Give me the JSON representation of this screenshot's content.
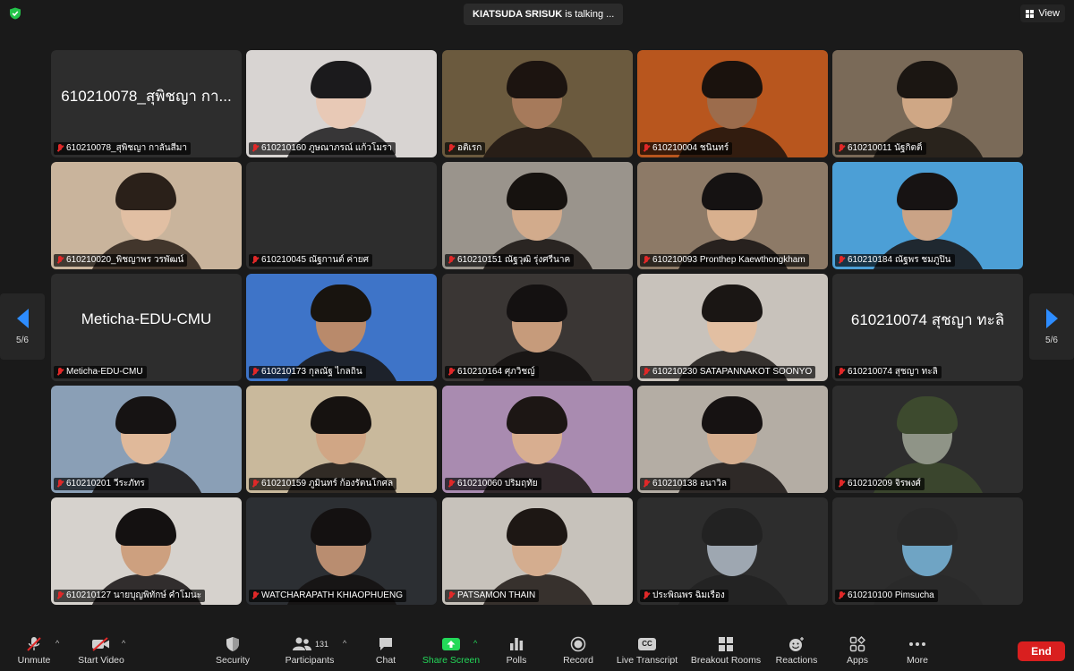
{
  "topbar": {
    "talking_name": "KIATSUDA SRISUK",
    "talking_suffix": "is talking ...",
    "view_label": "View"
  },
  "pager": {
    "left_label": "5/6",
    "right_label": "5/6"
  },
  "participants": [
    {
      "label": "610210078_สุพิชญา กาลันสีมา",
      "big_name": "610210078_สุพิชญา กา...",
      "video": false
    },
    {
      "label": "610210160 ภูษณาภรณ์ แก้วโมรา",
      "big_name": "",
      "video": true,
      "bg": "#d8d4d2",
      "skin": "#e8c9b6",
      "hair": "#1b1a1c"
    },
    {
      "label": "อติเรก",
      "big_name": "",
      "video": true,
      "bg": "#6b5a3e",
      "skin": "#a67a5b",
      "hair": "#1c1410"
    },
    {
      "label": "610210004 ชนินทร์",
      "big_name": "",
      "video": true,
      "bg": "#b8561e",
      "skin": "#9c6c4c",
      "hair": "#1a120d"
    },
    {
      "label": "610210011 นัฐกิตติ์",
      "big_name": "",
      "video": true,
      "bg": "#7a6a58",
      "skin": "#cfa785",
      "hair": "#1b1612"
    },
    {
      "label": "610210020_พิชญาพร วรพัฒน์",
      "big_name": "",
      "video": true,
      "bg": "#c9b49c",
      "skin": "#e1bfa3",
      "hair": "#2a2019"
    },
    {
      "label": "610210045 ณัฐกานต์ ค่ายศ",
      "big_name": "",
      "video": false
    },
    {
      "label": "610210151 ณัฐวุฒิ รุ่งศรีนาค",
      "big_name": "",
      "video": true,
      "bg": "#9a948c",
      "skin": "#d2ab8c",
      "hair": "#16120f"
    },
    {
      "label": "610210093 Pronthep Kaewthongkham",
      "big_name": "",
      "video": true,
      "bg": "#8d7a67",
      "skin": "#d8b08e",
      "hair": "#151212"
    },
    {
      "label": "610210184 ณัฐพร ชมภูปิน",
      "big_name": "",
      "video": true,
      "bg": "#4c9fd6",
      "skin": "#caa386",
      "hair": "#171313"
    },
    {
      "label": "Meticha-EDU-CMU",
      "big_name": "Meticha-EDU-CMU",
      "video": false
    },
    {
      "label": "610210173 กุลณัฐ ไกลถิ่น",
      "big_name": "",
      "video": true,
      "bg": "#3e74c8",
      "skin": "#b98a6b",
      "hair": "#18140f"
    },
    {
      "label": "610210164 ศุภวิชญ์",
      "big_name": "",
      "video": true,
      "bg": "#3a3634",
      "skin": "#c69b7b",
      "hair": "#141111"
    },
    {
      "label": "610210230 SATAPANNAKOT SOONYO",
      "big_name": "",
      "video": true,
      "bg": "#c8c2bb",
      "skin": "#e2bfa2",
      "hair": "#1a1614"
    },
    {
      "label": "610210074 สุชญา ทะลิ",
      "big_name": "610210074 สุชญา ทะลิ",
      "video": false
    },
    {
      "label": "610210201 วีระภัทร",
      "big_name": "",
      "video": true,
      "bg": "#8a9fb6",
      "skin": "#e0b99a",
      "hair": "#161313"
    },
    {
      "label": "610210159 ภูมินทร์ ก้องรัตนโกศล",
      "big_name": "",
      "video": true,
      "bg": "#c9b99c",
      "skin": "#d0a685",
      "hair": "#161210"
    },
    {
      "label": "610210060 ปริมฤทัย",
      "big_name": "",
      "video": true,
      "bg": "#a98bb0",
      "skin": "#d8ae90",
      "hair": "#1c1614"
    },
    {
      "label": "610210138 อนาวิล",
      "big_name": "",
      "video": true,
      "bg": "#b4ada4",
      "skin": "#d5ae8f",
      "hair": "#161212"
    },
    {
      "label": "610210209 จิรพงศ์",
      "big_name": "",
      "video": true,
      "bg": "#2d2d2d",
      "skin": "#8f9487",
      "hair": "#3d4a2e"
    },
    {
      "label": "610210127 นายบุญพิทักษ์ คำโมนะ",
      "big_name": "",
      "video": true,
      "bg": "#d6d2cd",
      "skin": "#cda07f",
      "hair": "#141111"
    },
    {
      "label": "WATCHARAPATH KHIAOPHUENG",
      "big_name": "",
      "video": true,
      "bg": "#2c2f33",
      "skin": "#b98d70",
      "hair": "#141111"
    },
    {
      "label": "PATSAMON THAIN",
      "big_name": "",
      "video": true,
      "bg": "#c7c2bb",
      "skin": "#d4ad8f",
      "hair": "#1d1714"
    },
    {
      "label": "ประพิณพร ฉิมเรือง",
      "big_name": "",
      "video": true,
      "bg": "#2d2d2d",
      "skin": "#9ea7b1",
      "hair": "#222"
    },
    {
      "label": "610210100 Pimsucha",
      "big_name": "",
      "video": true,
      "bg": "#2d2d2d",
      "skin": "#6fa4c4",
      "hair": "#2a2a2a"
    }
  ],
  "toolbar": {
    "unmute": "Unmute",
    "start_video": "Start Video",
    "security": "Security",
    "participants": "Participants",
    "participants_count": "131",
    "chat": "Chat",
    "share_screen": "Share Screen",
    "polls": "Polls",
    "record": "Record",
    "live_transcript": "Live Transcript",
    "live_transcript_icon_text": "CC",
    "breakout_rooms": "Breakout Rooms",
    "reactions": "Reactions",
    "apps": "Apps",
    "more": "More",
    "end": "End"
  },
  "colors": {
    "accent": "#2d8cff",
    "share_green": "#23d959",
    "end_red": "#d91f1f",
    "muted_red": "#e02828"
  }
}
